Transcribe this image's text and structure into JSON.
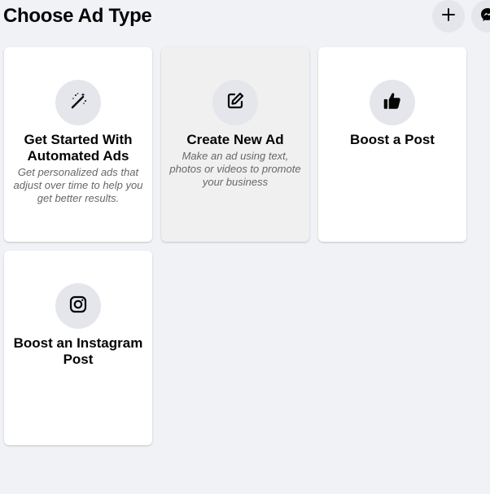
{
  "page": {
    "title": "Choose Ad Type"
  },
  "header_actions": {
    "create_icon": "plus-icon",
    "messenger_icon": "messenger-icon"
  },
  "cards": [
    {
      "title": "Get Started With Automated Ads",
      "description": "Get personalized ads that adjust over time to help you get better results.",
      "icon": "magic-wand-icon"
    },
    {
      "title": "Create New Ad",
      "description": "Make an ad using text, photos or videos to promote your business",
      "icon": "edit-icon"
    },
    {
      "title": "Boost a Post",
      "description": "",
      "icon": "thumbs-up-icon"
    },
    {
      "title": "Boost an Instagram Post",
      "description": "",
      "icon": "instagram-icon"
    }
  ],
  "colors": {
    "background": "#f0f2f5",
    "card": "#ffffff",
    "card_hover": "#f0f0f0",
    "icon_circle": "#e4e6eb",
    "secondary_text": "#65676b"
  }
}
